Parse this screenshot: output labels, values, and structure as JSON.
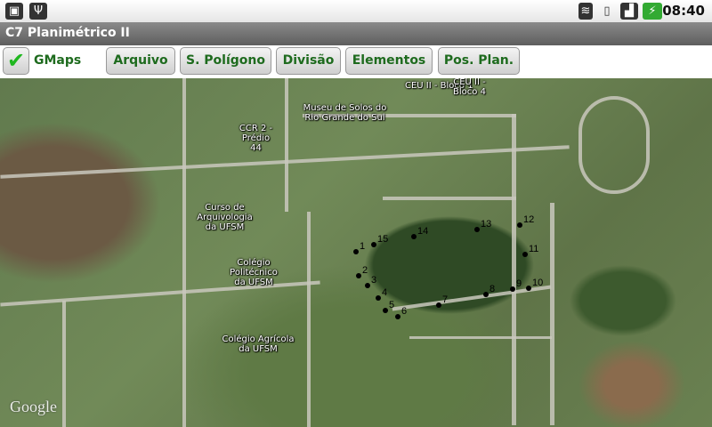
{
  "statusbar": {
    "time": "08:40",
    "icons": [
      "android-debug-icon",
      "usb-icon",
      "wifi-icon",
      "vibrate-icon",
      "signal-2g-icon",
      "battery-charging-icon"
    ]
  },
  "app": {
    "title": "C7 Planimétrico II"
  },
  "toolbar": {
    "gmaps_label": "GMaps",
    "gmaps_checked": true,
    "buttons": [
      "Arquivo",
      "S. Polígono",
      "Divisão",
      "Elementos",
      "Pos. Plan."
    ]
  },
  "map": {
    "labels": [
      "CEU II - Bloco 1",
      "CEU II - Bloco 4",
      "Museu de Solos do Rio Grande do Sul",
      "CCR 2 - Prédio 44",
      "Curso de Arquivologia da UFSM",
      "Colégio Politécnico da UFSM",
      "Colégio Agrícola da UFSM"
    ],
    "attribution": "Google",
    "polygon_points": [
      "1",
      "2",
      "3",
      "4",
      "5",
      "6",
      "7",
      "8",
      "9",
      "10",
      "11",
      "12",
      "13",
      "14",
      "15"
    ]
  }
}
